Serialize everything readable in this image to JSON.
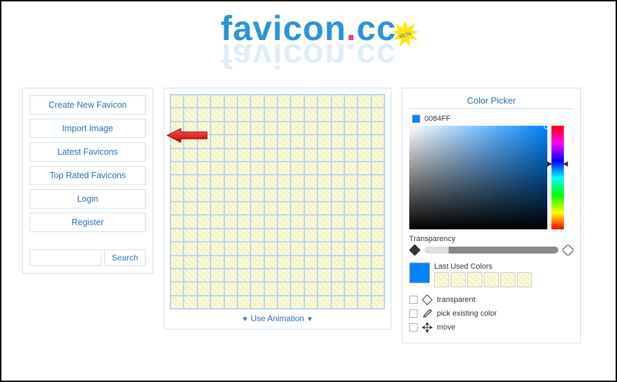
{
  "logo": {
    "part1": "favicon",
    "dot": ".",
    "part2": "cc",
    "badge": "BETA"
  },
  "nav": {
    "create": "Create New Favicon",
    "import": "Import Image",
    "latest": "Latest Favicons",
    "top": "Top Rated Favicons",
    "login": "Login",
    "register": "Register",
    "search_placeholder": "",
    "search_btn": "Search"
  },
  "editor": {
    "use_animation": "Use Animation"
  },
  "color_picker": {
    "title": "Color Picker",
    "current_hex": "0084FF",
    "transparency_label": "Transparency",
    "last_used_label": "Last Used Colors",
    "opt_transparent": "transparent",
    "opt_pick": "pick existing color",
    "opt_move": "move"
  }
}
